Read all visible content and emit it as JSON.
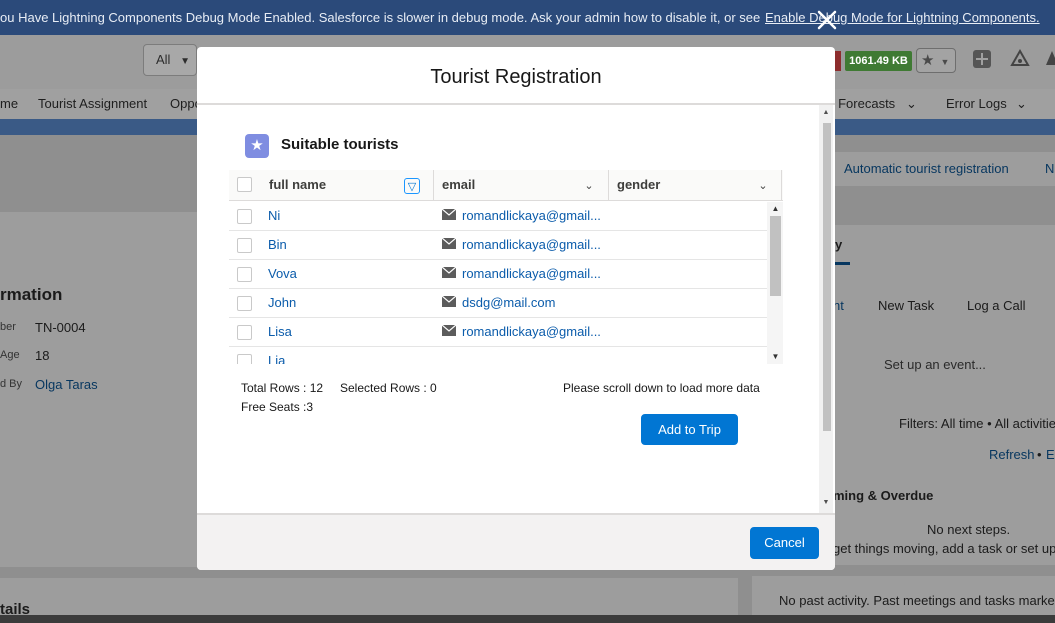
{
  "debug_bar": {
    "message": "ou Have Lightning Components Debug Mode Enabled. Salesforce is slower in debug mode. Ask your admin how to disable it, or see",
    "link": "Enable Debug Mode for Lightning Components."
  },
  "header": {
    "search_scope": "All",
    "memory": "1061.49 KB"
  },
  "nav": {
    "items": [
      "me",
      "Tourist Assignment",
      "Oppo",
      "y Forecasts",
      "Error Logs"
    ]
  },
  "background": {
    "section_title": "rmation",
    "fields": [
      {
        "label": "ber",
        "value": "TN-0004"
      },
      {
        "label": "Age",
        "value": "18"
      },
      {
        "label": "d By",
        "value": "Olga Taras"
      }
    ],
    "details_title": "tails",
    "right_tabs": [
      "Automatic tourist registration",
      "N"
    ],
    "activity_tab": "y",
    "activity_actions": [
      "nt",
      "New Task",
      "Log a Call"
    ],
    "event_placeholder": "Set up an event...",
    "filters": "Filters: All time • All activitie",
    "refresh": "Refresh",
    "refresh_sep": "•",
    "refresh_tail": "E",
    "upcoming": "ming & Overdue",
    "no_steps": "No next steps.",
    "no_steps_hint": "get things moving, add a task or set up",
    "no_activity": "No past activity. Past meetings and tasks marked"
  },
  "modal": {
    "title": "Tourist Registration",
    "card_title": "Suitable tourists",
    "columns": [
      "full name",
      "email",
      "gender"
    ],
    "rows": [
      {
        "name": "Ni",
        "email": "romandlickaya@gmail..."
      },
      {
        "name": "Bin",
        "email": "romandlickaya@gmail..."
      },
      {
        "name": "Vova",
        "email": "romandlickaya@gmail..."
      },
      {
        "name": "John",
        "email": "dsdg@mail.com"
      },
      {
        "name": "Lisa",
        "email": "romandlickaya@gmail..."
      },
      {
        "name": "Lia",
        "email": ""
      }
    ],
    "total_rows": "Total Rows : 12",
    "selected_rows": "Selected Rows : 0",
    "free_seats": "Free Seats :3",
    "scroll_hint": "Please scroll down to load more data",
    "add_button": "Add to Trip",
    "cancel_button": "Cancel"
  }
}
